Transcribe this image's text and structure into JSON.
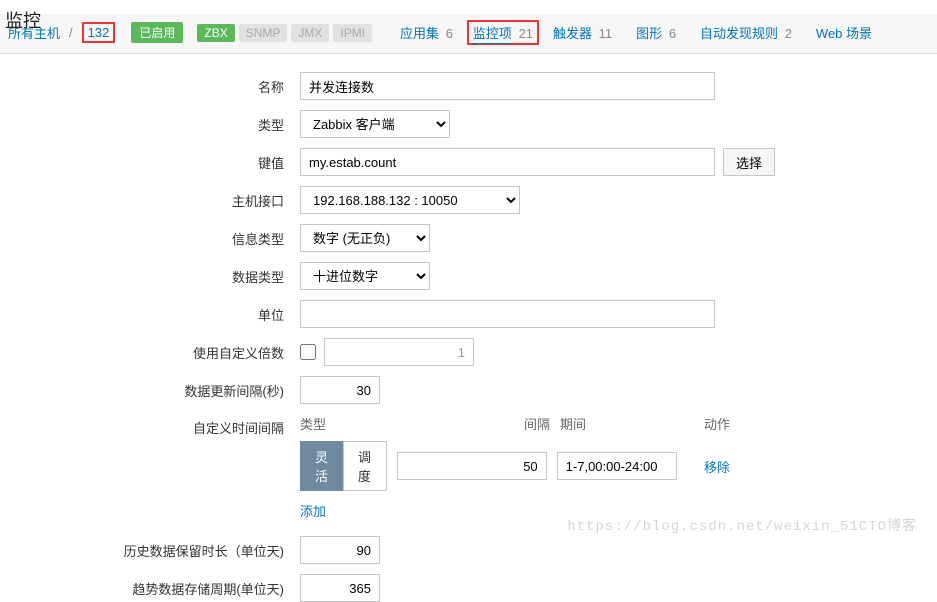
{
  "page_title_fragment": "监控",
  "breadcrumb": {
    "all_hosts": "所有主机",
    "host": "132",
    "enabled": "已启用"
  },
  "protocols": {
    "zbx": "ZBX",
    "snmp": "SNMP",
    "jmx": "JMX",
    "ipmi": "IPMI"
  },
  "tabs": {
    "apps": {
      "label": "应用集",
      "count": "6"
    },
    "items": {
      "label": "监控项",
      "count": "21"
    },
    "triggers": {
      "label": "触发器",
      "count": "11"
    },
    "graphs": {
      "label": "图形",
      "count": "6"
    },
    "discovery": {
      "label": "自动发现规则",
      "count": "2"
    },
    "web": {
      "label": "Web 场景",
      "count": ""
    }
  },
  "labels": {
    "name": "名称",
    "type": "类型",
    "key": "键值",
    "select": "选择",
    "iface": "主机接口",
    "info_type": "信息类型",
    "data_type": "数据类型",
    "unit": "单位",
    "multiplier": "使用自定义倍数",
    "update_interval": "数据更新间隔(秒)",
    "custom_intervals": "自定义时间间隔",
    "history": "历史数据保留时长（单位天)",
    "trend": "趋势数据存储周期(单位天)"
  },
  "values": {
    "name": "并发连接数",
    "type": "Zabbix 客户端",
    "key": "my.estab.count",
    "iface": "192.168.188.132 : 10050",
    "info_type": "数字 (无正负)",
    "data_type": "十进位数字",
    "unit": "",
    "multiplier": "1",
    "update_interval": "30",
    "history": "90",
    "trend": "365"
  },
  "intervals": {
    "head_type": "类型",
    "head_int": "间隔",
    "head_period": "期间",
    "head_action": "动作",
    "flex": "灵活",
    "sched": "调度",
    "int_val": "50",
    "period_val": "1-7,00:00-24:00",
    "remove": "移除",
    "add": "添加"
  },
  "watermark": "https://blog.csdn.net/weixin_51CTO博客"
}
